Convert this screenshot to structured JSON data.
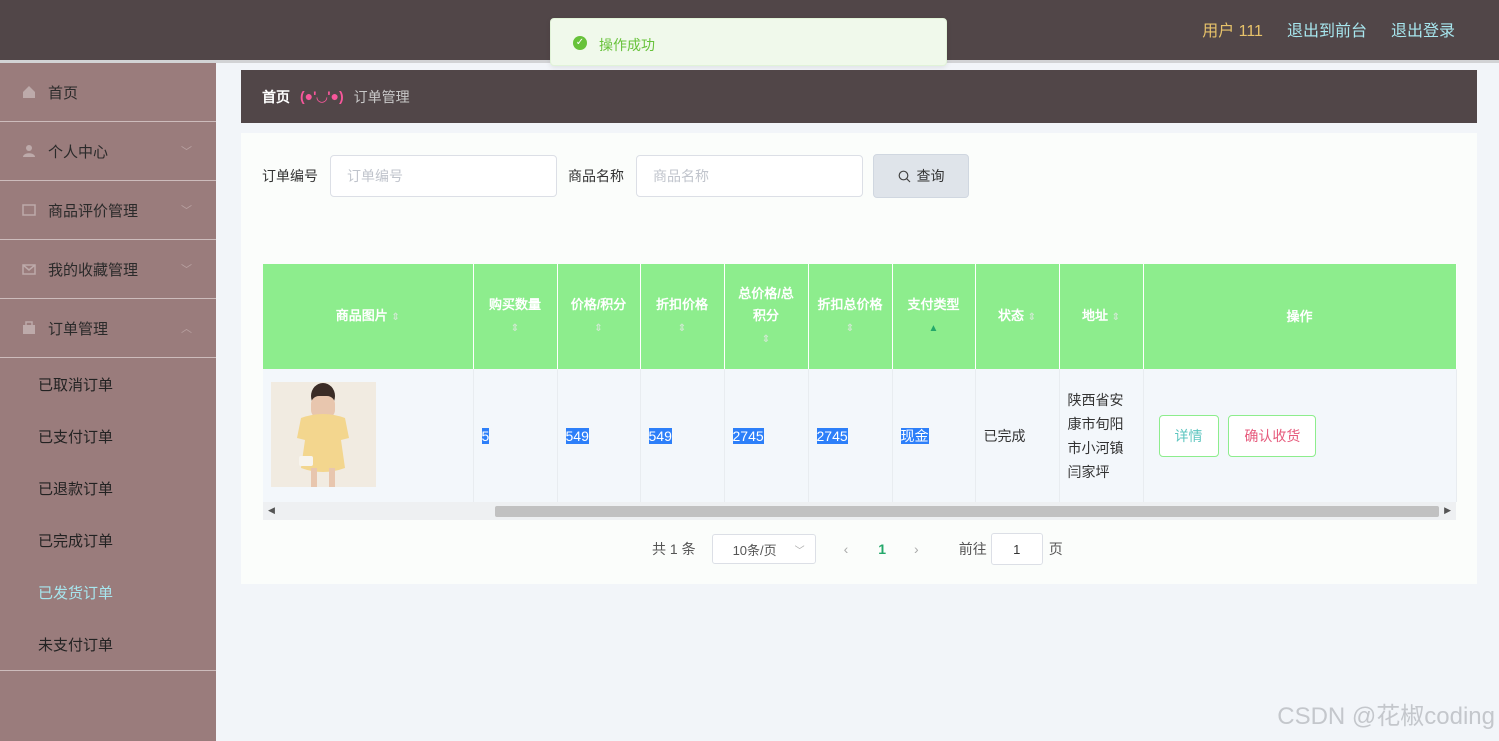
{
  "header": {
    "user": "用户 111",
    "links": [
      "退出到前台",
      "退出登录"
    ]
  },
  "toast": {
    "message": "操作成功"
  },
  "sidebar": {
    "items": [
      {
        "label": "首页",
        "icon": "home-icon"
      },
      {
        "label": "个人中心",
        "icon": "user-icon"
      },
      {
        "label": "商品评价管理",
        "icon": "review-icon"
      },
      {
        "label": "我的收藏管理",
        "icon": "favorite-icon"
      },
      {
        "label": "订单管理",
        "icon": "order-icon"
      }
    ],
    "sub_items": [
      "已取消订单",
      "已支付订单",
      "已退款订单",
      "已完成订单",
      "已发货订单",
      "未支付订单"
    ],
    "active_sub": "已发货订单"
  },
  "breadcrumb": {
    "home": "首页",
    "face": "(●'◡'●)",
    "current": "订单管理"
  },
  "search": {
    "order_no_label": "订单编号",
    "order_no_placeholder": "订单编号",
    "product_label": "商品名称",
    "product_placeholder": "商品名称",
    "query_label": "查询"
  },
  "table": {
    "headers": [
      "商品图片",
      "购买数量",
      "价格/积分",
      "折扣价格",
      "总价格/总积分",
      "折扣总价格",
      "支付类型",
      "状态",
      "地址",
      "操作"
    ],
    "rows": [
      {
        "quantity": "5",
        "price": "549",
        "discount_price": "549",
        "total": "2745",
        "discount_total": "2745",
        "pay_type": "现金",
        "status": "已完成",
        "address": "陕西省安康市旬阳市小河镇闫家坪"
      }
    ],
    "actions": {
      "detail": "详情",
      "confirm": "确认收货"
    }
  },
  "pagination": {
    "total": "共 1 条",
    "page_size": "10条/页",
    "current": "1",
    "goto_label": "前往",
    "goto_value": "1",
    "page_unit": "页"
  },
  "watermark": "CSDN @花椒coding",
  "colors": {
    "topbar": "#514648",
    "sidebar": "#9a7c7c",
    "table_header": "#8ded8d",
    "accent": "#23a86a",
    "selection": "#2d7ff9"
  }
}
